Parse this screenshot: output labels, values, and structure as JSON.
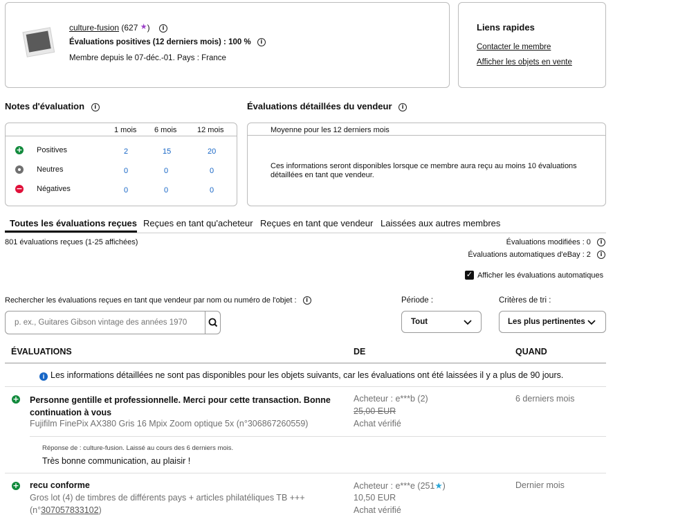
{
  "profile": {
    "username": "culture-fusion",
    "score": "(627",
    "score_close": ")",
    "positive_label": "Évaluations positives (12 derniers mois) : 100 %",
    "member_since": "Membre depuis le 07-déc.-01. Pays : France"
  },
  "quick_links": {
    "title": "Liens rapides",
    "contact": "Contacter le membre",
    "items_for_sale": "Afficher les objets en vente"
  },
  "ratings": {
    "title": "Notes d'évaluation",
    "columns": [
      "1 mois",
      "6 mois",
      "12 mois"
    ],
    "rows": [
      {
        "label": "Positives",
        "values": [
          "2",
          "15",
          "20"
        ]
      },
      {
        "label": "Neutres",
        "values": [
          "0",
          "0",
          "0"
        ]
      },
      {
        "label": "Négatives",
        "values": [
          "0",
          "0",
          "0"
        ]
      }
    ]
  },
  "detailed": {
    "title": "Évaluations détaillées du vendeur",
    "subtitle": "Moyenne pour les 12 derniers mois",
    "message": "Ces informations seront disponibles lorsque ce membre aura reçu au moins 10 évaluations détaillées en tant que vendeur."
  },
  "tabs": [
    "Toutes les évaluations reçues",
    "Reçues en tant qu'acheteur",
    "Reçues en tant que vendeur",
    "Laissées aux autres membres"
  ],
  "summary": {
    "count": "801 évaluations reçues (1-25 affichées)",
    "modified": "Évaluations modifiées : 0",
    "automatic": "Évaluations automatiques d'eBay : 2",
    "show_automatic": "Afficher les évaluations automatiques"
  },
  "search": {
    "label": "Rechercher les évaluations reçues en tant que vendeur par nom ou numéro de l'objet :",
    "placeholder": "p. ex., Guitares Gibson vintage des années 1970"
  },
  "period": {
    "label": "Période :",
    "value": "Tout"
  },
  "sort": {
    "label": "Critères de tri :",
    "value": "Les plus pertinentes"
  },
  "table": {
    "headers": [
      "ÉVALUATIONS",
      "DE",
      "QUAND"
    ],
    "notice": "Les informations détaillées ne sont pas disponibles pour les objets suivants, car les évaluations ont été laissées il y a plus de 90 jours.",
    "rows": [
      {
        "comment": "Personne gentille et professionnelle. Merci pour cette transaction. Bonne continuation à vous",
        "item": "Fujifilm FinePix AX380 Gris 16 Mpix Zoom optique 5x (n°306867260559)",
        "buyer": "Acheteur : e***b (2)",
        "price": "25,00 EUR",
        "verified": "Achat vérifié",
        "when": "6 derniers mois",
        "reply_meta": "Réponse de : culture-fusion. Laissé au cours des 6 derniers mois.",
        "reply": "Très bonne communication, au plaisir !"
      },
      {
        "comment": "recu conforme",
        "item": "Gros lot (4) de timbres de différents pays + articles philatéliques TB +++",
        "item_id_prefix": "(n°",
        "item_id": "307057833102",
        "item_id_suffix": ")",
        "buyer": "Acheteur : e***e (251",
        "buyer_close": ")",
        "price": "10,50 EUR",
        "verified": "Achat vérifié",
        "when": "Dernier mois"
      }
    ]
  },
  "colors": {
    "positive": "#118a3c",
    "neutral": "#707070",
    "negative": "#e0103a",
    "link": "#1766c6",
    "star_purple": "#9b3fc7",
    "star_teal": "#2aa7d8"
  }
}
